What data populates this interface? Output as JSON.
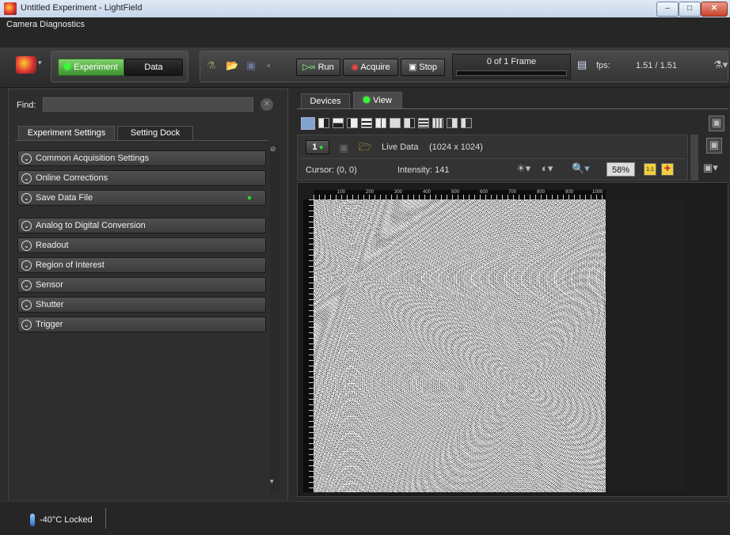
{
  "window": {
    "title": "Untitled Experiment - LightField",
    "min": "–",
    "max": "□",
    "close": "✕"
  },
  "menu": {
    "item": "Camera Diagnostics"
  },
  "toolbar": {
    "experiment": "Experiment",
    "data": "Data",
    "run": "Run",
    "acquire": "Acquire",
    "stop": "Stop",
    "frame_counter": "0 of 1 Frame",
    "progress": 0,
    "fps_label": "fps:",
    "fps_value": "1.51 / 1.51"
  },
  "left": {
    "find_label": "Find:",
    "find_value": "",
    "tabs": [
      "Experiment Settings",
      "Setting Dock"
    ],
    "sections_top": [
      "Common Acquisition Settings",
      "Online Corrections",
      "Save Data File"
    ],
    "sections_bottom": [
      "Analog to Digital Conversion",
      "Readout",
      "Region of Interest",
      "Sensor",
      "Shutter",
      "Trigger"
    ]
  },
  "right": {
    "tabs": [
      "Devices",
      "View"
    ],
    "frame_number": "1",
    "live_data": "Live Data",
    "dimensions": "(1024 x 1024)",
    "cursor": "Cursor: (0, 0)",
    "intensity": "Intensity: 141",
    "zoom": "58%",
    "one_to_one": "1:1",
    "ruler_ticks": [
      "100",
      "200",
      "300",
      "400",
      "500",
      "600",
      "700",
      "800",
      "900",
      "1000"
    ]
  },
  "status": {
    "temperature": "-40°C Locked"
  },
  "colors": {
    "accent_green": "#3e8f2f",
    "background": "#2b2b2b"
  }
}
